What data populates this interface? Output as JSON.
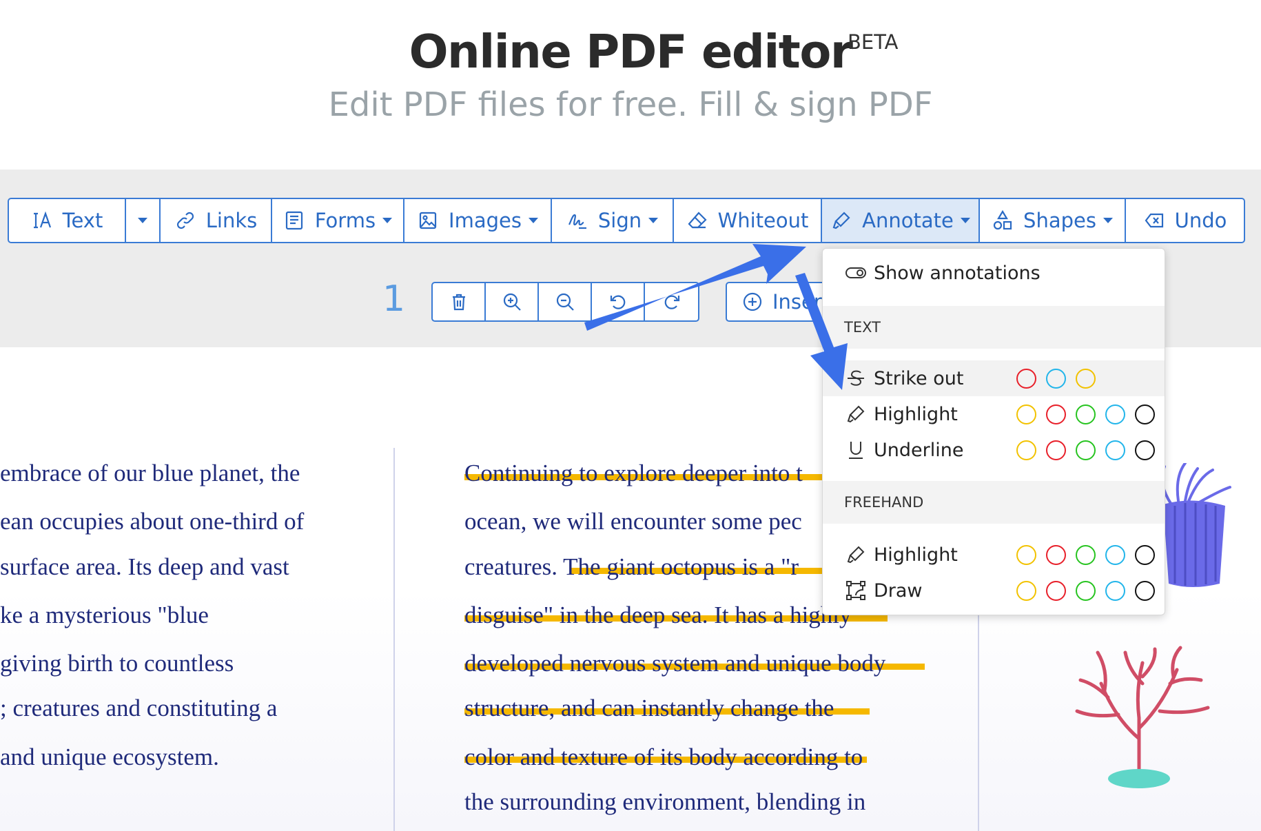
{
  "header": {
    "title": "Online PDF editor",
    "beta": "BETA",
    "subtitle": "Edit PDF files for free. Fill & sign PDF"
  },
  "toolbar": {
    "text": "Text",
    "links": "Links",
    "forms": "Forms",
    "images": "Images",
    "sign": "Sign",
    "whiteout": "Whiteout",
    "annotate": "Annotate",
    "shapes": "Shapes",
    "undo": "Undo"
  },
  "page_controls": {
    "page_number": "1",
    "insert_label": "Insert"
  },
  "annotate_menu": {
    "show_annotations": "Show annotations",
    "section_text": "TEXT",
    "strike_out": "Strike out",
    "highlight": "Highlight",
    "underline": "Underline",
    "section_freehand": "FREEHAND",
    "freehand_highlight": "Highlight",
    "draw": "Draw",
    "colors": {
      "red": "#e8202a",
      "blue": "#22b5ea",
      "yellow": "#f2c200",
      "green": "#27c420",
      "black": "#111111"
    }
  },
  "document": {
    "left_column": [
      "embrace of our blue planet, the",
      "ean occupies about one-third of",
      "surface area. Its deep and vast",
      "ke a mysterious \"blue",
      "giving birth to countless",
      "; creatures and constituting a",
      "and unique ecosystem."
    ],
    "right_column": [
      "Continuing to explore deeper into t",
      "ocean, we will encounter some pec",
      "creatures. The giant octopus is a \"r",
      "disguise\" in the deep sea. It has a highly",
      "developed nervous system and unique body",
      "structure, and can instantly change the",
      "color and texture of its body according to",
      "the surrounding environment, blending in"
    ]
  }
}
